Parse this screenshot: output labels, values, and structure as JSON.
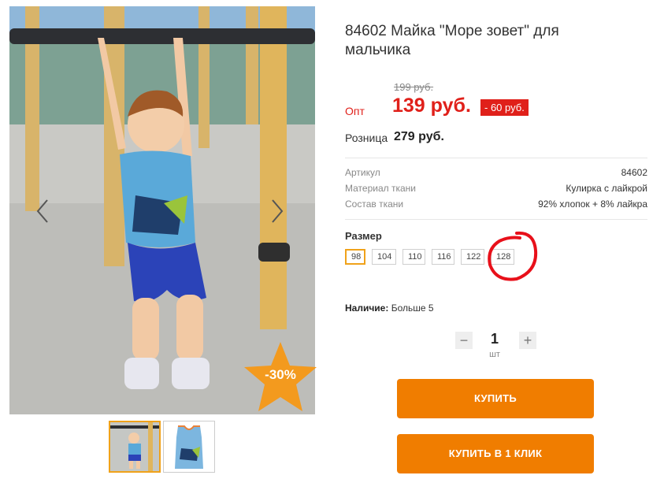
{
  "product": {
    "title": "84602 Майка \"Море зовет\" для мальчика",
    "sale_badge": "-30%"
  },
  "prices": {
    "old_price": "199 руб.",
    "opt_label": "Опт",
    "opt_price": "139 руб.",
    "discount": "- 60 руб.",
    "retail_label": "Розница",
    "retail_price": "279 руб."
  },
  "specs": [
    {
      "key": "Артикул",
      "value": "84602"
    },
    {
      "key": "Материал ткани",
      "value": "Кулирка с лайкрой"
    },
    {
      "key": "Состав ткани",
      "value": "92% хлопок + 8% лайкра"
    }
  ],
  "sizes": {
    "title": "Размер",
    "options": [
      "98",
      "104",
      "110",
      "116",
      "122",
      "128"
    ],
    "selected": "98"
  },
  "availability": {
    "label": "Наличие:",
    "value": "Больше 5"
  },
  "quantity": {
    "minus": "−",
    "value": "1",
    "unit": "шт",
    "plus": "+"
  },
  "buttons": {
    "buy": "КУПИТЬ",
    "one_click": "КУПИТЬ В 1 КЛИК"
  },
  "gallery": {
    "prev_icon": "chevron-left-icon",
    "next_icon": "chevron-right-icon"
  },
  "colors": {
    "accent": "#f07d00",
    "price_red": "#e0201a",
    "selected_border": "#f0a21a",
    "annotation_circle": "#e8101a"
  }
}
